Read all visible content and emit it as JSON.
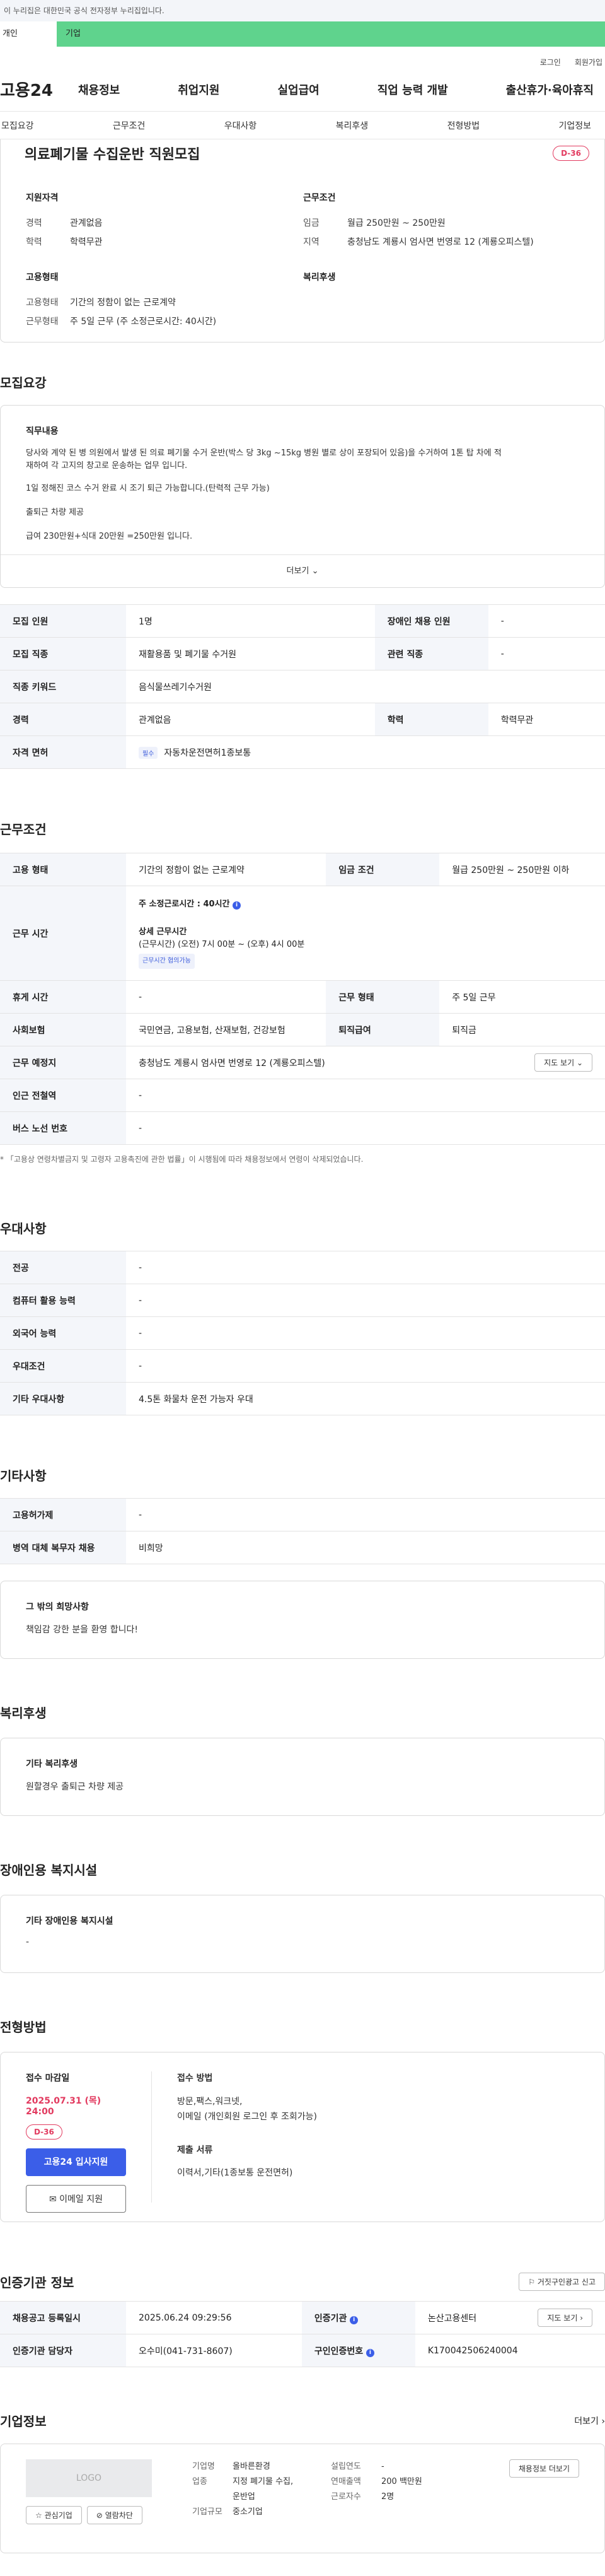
{
  "notice": "이 누리집은 대한민국 공식 전자정부 누리집입니다.",
  "tabs": {
    "individual": "개인",
    "business": "기업"
  },
  "util": {
    "login": "로그인",
    "join": "회원가입"
  },
  "logo": "고용24",
  "gnb": [
    "채용정보",
    "취업지원",
    "실업급여",
    "직업 능력 개발",
    "출산휴가·육아휴직"
  ],
  "anchors": [
    "모집요강",
    "근무조건",
    "우대사항",
    "복리후생",
    "전형방법",
    "기업정보"
  ],
  "job": {
    "title": "의료폐기물 수집운반 직원모집",
    "dday": "D-36",
    "qual_title": "지원자격",
    "career_k": "경력",
    "career_v": "관계없음",
    "edu_k": "학력",
    "edu_v": "학력무관",
    "cond_title": "근무조건",
    "wage_k": "임금",
    "wage_v": "월급 250만원 ~ 250만원",
    "loc_k": "지역",
    "loc_v": "충청남도 계룡시 엄사면 번영로 12 (계룡오피스텔)",
    "emp_title": "고용형태",
    "emp_k": "고용형태",
    "emp_v": "기간의 정함이 없는 근로계약",
    "worktype_k": "근무형태",
    "worktype_v": "주 5일 근무 (주 소정근로시간: 40시간)",
    "welfare_title": "복리후생"
  },
  "recruit": {
    "title": "모집요강",
    "duty_title": "직무내용",
    "duty_lines": [
      "당사와 계약 된 병 의원에서 발생  된 의료 폐기물    수거 운반(박스 당 3kg ~15kg  병원 별로 상이 포장되어 있음)을 수거하여 1톤 탑 차에 적",
      "재하여 각 고지의 창고로 운송하는 업무 입니다.",
      "1일 정해진 코스 수거 완료 시 조기 퇴근 가능합니다.(탄력적 근무 가능)",
      "출퇴근 차량 제공",
      "급여 230만원+식대 20만원 =250만원 입니다."
    ],
    "more": "더보기",
    "rows": [
      {
        "k1": "모집 인원",
        "v1": "1명",
        "k2": "장애인 채용 인원",
        "v2": "-"
      },
      {
        "k1": "모집 직종",
        "v1": "재활용품 및 폐기물 수거원",
        "k2": "관련 직종",
        "v2": "-"
      }
    ],
    "keyword_k": "직종 키워드",
    "keyword_v": "음식물쓰레기수거원",
    "career_k": "경력",
    "career_v": "관계없음",
    "edu_k": "학력",
    "edu_v": "학력무관",
    "license_k": "자격 면허",
    "license_tag": "필수",
    "license_v": "자동차운전면허1종보통"
  },
  "conditions": {
    "title": "근무조건",
    "emp_k": "고용 형태",
    "emp_v": "기간의 정함이 없는 근로계약",
    "wage_k": "임금 조건",
    "wage_v": "월급 250만원 ~ 250만원 이하",
    "time_k": "근무 시간",
    "weekly": "주 소정근로시간 : 40시간",
    "detail_title": "상세 근무시간",
    "detail_v": "(근무시간) (오전) 7시 00분 ~ (오후) 4시 00분",
    "flex_tag": "근무시간 협의가능",
    "rest_k": "휴게 시간",
    "rest_v": "-",
    "form_k": "근무 형태",
    "form_v": "주 5일 근무",
    "ins_k": "사회보험",
    "ins_v": "국민연금, 고용보험, 산재보험, 건강보험",
    "sev_k": "퇴직급여",
    "sev_v": "퇴직금",
    "place_k": "근무 예정지",
    "place_v": "충청남도 계룡시 엄사면 번영로 12 (계룡오피스텔)",
    "map_btn": "지도 보기",
    "subway_k": "인근 전철역",
    "subway_v": "-",
    "bus_k": "버스 노선 번호",
    "bus_v": "-",
    "note": "* 「고용상 연령차별금지 및 고령자 고용촉진에 관한 법률」이 시행됨에 따라 채용정보에서 연령이 삭제되었습니다."
  },
  "pref": {
    "title": "우대사항",
    "rows": [
      {
        "k": "전공",
        "v": "-"
      },
      {
        "k": "컴퓨터 활용 능력",
        "v": "-"
      },
      {
        "k": "외국어 능력",
        "v": "-"
      },
      {
        "k": "우대조건",
        "v": "-"
      },
      {
        "k": "기타 우대사항",
        "v": "4.5톤 화물차 운전 가능자 우대"
      }
    ]
  },
  "etc": {
    "title": "기타사항",
    "rows": [
      {
        "k": "고용허가제",
        "v": "-"
      },
      {
        "k": "병역 대체 복무자 채용",
        "v": "비희망"
      }
    ],
    "other_title": "그 밖의 희망사항",
    "other_v": "책임감 강한 분을 환영 합니다!"
  },
  "welfare": {
    "title": "복리후생",
    "sub": "기타 복리후생",
    "v": "원할경우 출퇴근 차량 제공"
  },
  "disab": {
    "title": "장애인용 복지시설",
    "sub": "기타 장애인용 복지시설",
    "v": "-"
  },
  "apply": {
    "title": "전형방법",
    "deadline_k": "접수 마감일",
    "deadline_v": "2025.07.31 (목) 24:00",
    "dday": "D-36",
    "btn_apply": "고용24 입사지원",
    "btn_email": "이메일 지원",
    "method_k": "접수 방법",
    "method_v1": "방문,팩스,워크넷,",
    "method_v2": "이메일 (개인회원 로그인 후 조회가능)",
    "docs_k": "제출 서류",
    "docs_v": "이력서,기타(1종보통 운전면허)"
  },
  "cert": {
    "title": "인증기관 정보",
    "report_btn": "거짓구인광고 신고",
    "reg_k": "채용공고 등록일시",
    "reg_v": "2025.06.24 09:29:56",
    "org_k": "인증기관",
    "org_v": "논산고용센터",
    "map_btn": "지도 보기",
    "mgr_k": "인증기관 담당자",
    "mgr_v": "오수미(041-731-8607)",
    "no_k": "구인인증번호",
    "no_v": "K170042506240004"
  },
  "company": {
    "title": "기업정보",
    "more": "더보기",
    "logo": "LOGO",
    "interest": "관심기업",
    "block": "열람차단",
    "ind_k": "기업명",
    "ind_v": "올바른환경",
    "biz_k": "업종",
    "biz_v1": "지정 폐기물 수집,",
    "biz_v2": "운반업",
    "size_k": "기업규모",
    "size_v": "중소기업",
    "year_k": "설립연도",
    "year_v": "-",
    "sales_k": "연매출액",
    "sales_v": "200 백만원",
    "staff_k": "근로자수",
    "staff_v": "2명",
    "recruit_btn": "채용정보 더보기"
  }
}
